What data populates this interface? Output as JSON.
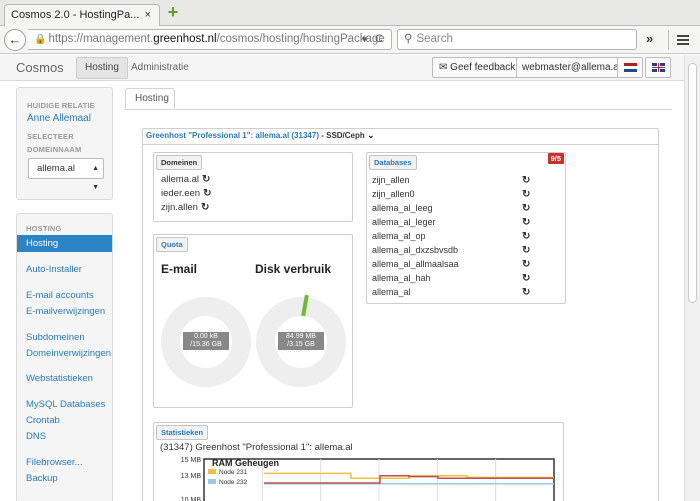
{
  "browser": {
    "tab_title": "Cosmos 2.0 - HostingPa...",
    "tab_close": "×",
    "new_tab": "+",
    "back": "←",
    "url_prefix": "https://management.",
    "url_domain": "greenhost.nl",
    "url_path": "/cosmos/hosting/hostingPackage",
    "url_dropdown": "▾",
    "reload": "C",
    "search_placeholder": "Search",
    "overflow": "»"
  },
  "site": {
    "brand": "Cosmos",
    "nav": [
      "Hosting",
      "Administratie"
    ],
    "feedback": "Geef feedback!",
    "user": "webmaster@allema.al",
    "flag_nl_colors": [
      "#ae1c28",
      "#ffffff",
      "#21468b"
    ]
  },
  "sidebar": {
    "relation_label": "HUIDIGE RELATIE",
    "relation_name": "Anne Allemaal",
    "select_label_1": "SELECTEER",
    "select_label_2": "DOMEINNAAM",
    "selected_domain": "allema.al",
    "section_label": "HOSTING",
    "items": [
      "Hosting",
      "Auto-Installer",
      "E-mail accounts",
      "E-mailverwijzingen",
      "Subdomeinen",
      "Domeinverwijzingen",
      "Webstatistieken",
      "MySQL Databases",
      "Crontab",
      "DNS",
      "Filebrowser...",
      "Backup"
    ],
    "active_item": "Hosting"
  },
  "main": {
    "tab": "Hosting",
    "package_name": "Greenhost \"Professional 1\": allema.al (31347)",
    "package_type": " - SSD/Ceph",
    "domains": {
      "title": "Domeinen",
      "items": [
        "allema.al",
        "ieder.een",
        "zijn.allen"
      ]
    },
    "databases": {
      "title": "Databases",
      "badge": "9/5",
      "items": [
        "zijn_allen",
        "zijn_allen0",
        "allema_al_leeg",
        "allema_al_leger",
        "allema_al_op",
        "allema_al_dxzsbvsdb",
        "allema_al_allmaalsaa",
        "allema_al_hah",
        "allema_al"
      ]
    },
    "quota": {
      "title": "Quota",
      "email_title": "E-mail",
      "email_used": "0.00 kB",
      "email_total": "/15.36 GB",
      "email_fraction": 0.0,
      "disk_title": "Disk verbruik",
      "disk_used": "84.99 MB",
      "disk_total": "/3.15 GB",
      "disk_fraction": 0.026
    },
    "stats": {
      "title": "Statistieken",
      "subtitle": "(31347) Greenhost \"Professional 1\": allema.al"
    }
  },
  "chart_data": {
    "type": "line",
    "title": "RAM Geheugen",
    "ylabel": "",
    "ytick_labels": [
      "15 MB",
      "13 MB",
      "10 MB"
    ],
    "ylim": [
      10,
      15
    ],
    "series": [
      {
        "name": "Node 231",
        "color": "#f0c040",
        "values": [
          13.2,
          13.2,
          13.2,
          12.6,
          12.6,
          12.9,
          12.9,
          12.7,
          12.7,
          12.7,
          12.7
        ]
      },
      {
        "name": "Node 232",
        "color": "#9cc6ea",
        "values": [
          11.9,
          11.9,
          11.9,
          11.9,
          11.9,
          11.9,
          11.9,
          11.9,
          11.9,
          11.9,
          11.9
        ]
      },
      {
        "name": "",
        "color": "#c0504d",
        "values": [
          12.0,
          12.0,
          12.0,
          12.0,
          12.9,
          12.8,
          12.6,
          12.6,
          12.6,
          12.6,
          12.6
        ]
      }
    ],
    "grid": true,
    "legend": "top-left"
  }
}
